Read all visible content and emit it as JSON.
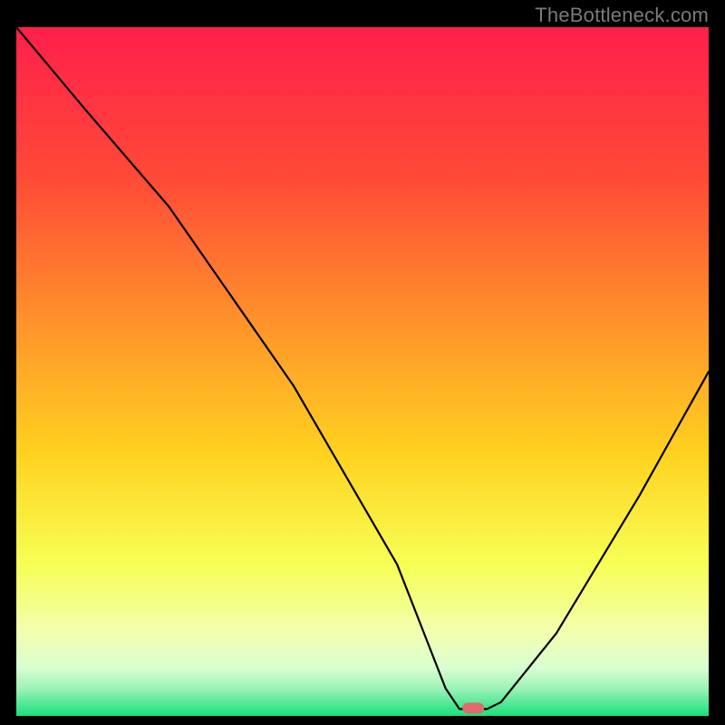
{
  "watermark": "TheBottleneck.com",
  "colors": {
    "gradient_top": "#ff1f4b",
    "gradient_mid_upper": "#ff8a2a",
    "gradient_mid": "#ffd21f",
    "gradient_lower": "#f7ff6a",
    "gradient_pale": "#f3ffd2",
    "gradient_bottom": "#19e07a",
    "curve": "#000000",
    "marker": "#e06a6d",
    "background": "#000000"
  },
  "chart_data": {
    "type": "line",
    "title": "",
    "xlabel": "",
    "ylabel": "",
    "xlim": [
      0,
      100
    ],
    "ylim": [
      0,
      100
    ],
    "series": [
      {
        "name": "bottleneck-curve",
        "x": [
          0,
          10,
          22,
          40,
          55,
          62,
          64,
          68,
          70,
          78,
          90,
          100
        ],
        "y": [
          100,
          88,
          74,
          48,
          22,
          4,
          1,
          1,
          2,
          12,
          32,
          50
        ]
      }
    ],
    "marker": {
      "x": 66,
      "y": 1
    },
    "annotations": []
  }
}
